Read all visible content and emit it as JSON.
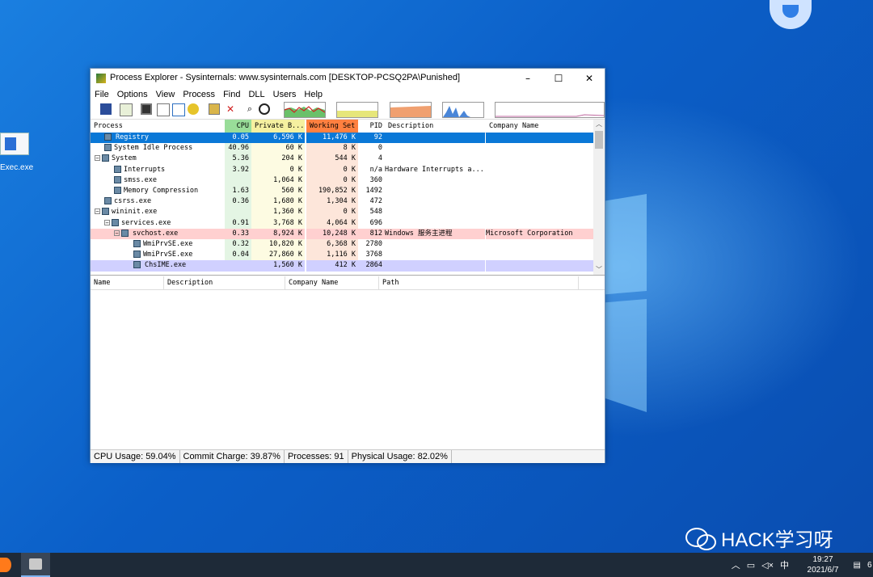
{
  "desktop": {
    "icon_label": "Exec.exe",
    "watermark": "HACK学习呀"
  },
  "window": {
    "title": "Process Explorer - Sysinternals: www.sysinternals.com [DESKTOP-PCSQ2PA\\Punished]",
    "minimize": "–",
    "maximize": "☐",
    "close": "✕"
  },
  "menu": [
    "File",
    "Options",
    "View",
    "Process",
    "Find",
    "DLL",
    "Users",
    "Help"
  ],
  "process_list": {
    "headers": {
      "process": "Process",
      "cpu": "CPU",
      "private": "Private B...",
      "working": "Working Set",
      "pid": "PID",
      "description": "Description",
      "company": "Company Name"
    },
    "rows": [
      {
        "name": "Registry",
        "indent": 1,
        "expander": "",
        "cpu": "0.05",
        "private": "6,596 K",
        "working": "11,476 K",
        "pid": "92",
        "description": "",
        "company": "",
        "style": "selected"
      },
      {
        "name": "System Idle Process",
        "indent": 1,
        "expander": "",
        "cpu": "40.96",
        "private": "60 K",
        "working": "8 K",
        "pid": "0",
        "description": "",
        "company": "",
        "style": "normal"
      },
      {
        "name": "System",
        "indent": 0,
        "expander": "−",
        "cpu": "5.36",
        "private": "204 K",
        "working": "544 K",
        "pid": "4",
        "description": "",
        "company": "",
        "style": "normal"
      },
      {
        "name": "Interrupts",
        "indent": 2,
        "expander": "",
        "cpu": "3.92",
        "private": "0 K",
        "working": "0 K",
        "pid": "n/a",
        "description": "Hardware Interrupts a...",
        "company": "",
        "style": "normal"
      },
      {
        "name": "smss.exe",
        "indent": 2,
        "expander": "",
        "cpu": "",
        "private": "1,064 K",
        "working": "0 K",
        "pid": "360",
        "description": "",
        "company": "",
        "style": "normal"
      },
      {
        "name": "Memory Compression",
        "indent": 2,
        "expander": "",
        "cpu": "1.63",
        "private": "560 K",
        "working": "190,852 K",
        "pid": "1492",
        "description": "",
        "company": "",
        "style": "normal"
      },
      {
        "name": "csrss.exe",
        "indent": 1,
        "expander": "",
        "cpu": "0.36",
        "private": "1,680 K",
        "working": "1,304 K",
        "pid": "472",
        "description": "",
        "company": "",
        "style": "normal"
      },
      {
        "name": "wininit.exe",
        "indent": 0,
        "expander": "−",
        "cpu": "",
        "private": "1,360 K",
        "working": "0 K",
        "pid": "548",
        "description": "",
        "company": "",
        "style": "normal"
      },
      {
        "name": "services.exe",
        "indent": 1,
        "expander": "−",
        "cpu": "0.91",
        "private": "3,768 K",
        "working": "4,064 K",
        "pid": "696",
        "description": "",
        "company": "",
        "style": "normal"
      },
      {
        "name": "svchost.exe",
        "indent": 2,
        "expander": "−",
        "cpu": "0.33",
        "private": "8,924 K",
        "working": "10,248 K",
        "pid": "812",
        "description": "Windows 服务主进程",
        "company": "Microsoft Corporation",
        "style": "service"
      },
      {
        "name": "WmiPrvSE.exe",
        "indent": 4,
        "expander": "",
        "cpu": "0.32",
        "private": "10,820 K",
        "working": "6,368 K",
        "pid": "2780",
        "description": "",
        "company": "",
        "style": "normal"
      },
      {
        "name": "WmiPrvSE.exe",
        "indent": 4,
        "expander": "",
        "cpu": "0.04",
        "private": "27,860 K",
        "working": "1,116 K",
        "pid": "3768",
        "description": "",
        "company": "",
        "style": "normal"
      },
      {
        "name": "ChsIME.exe",
        "indent": 4,
        "expander": "",
        "cpu": "",
        "private": "1,560 K",
        "working": "412 K",
        "pid": "2864",
        "description": "",
        "company": "",
        "style": "user"
      }
    ]
  },
  "dll_pane": {
    "headers": {
      "name": "Name",
      "description": "Description",
      "company": "Company Name",
      "path": "Path"
    }
  },
  "status": {
    "cpu": "CPU Usage: 59.04%",
    "commit": "Commit Charge: 39.87%",
    "processes": "Processes: 91",
    "physical": "Physical Usage: 82.02%"
  },
  "taskbar": {
    "ime": "中",
    "time": "19:27",
    "date": "2021/6/7",
    "notifications": "6"
  }
}
